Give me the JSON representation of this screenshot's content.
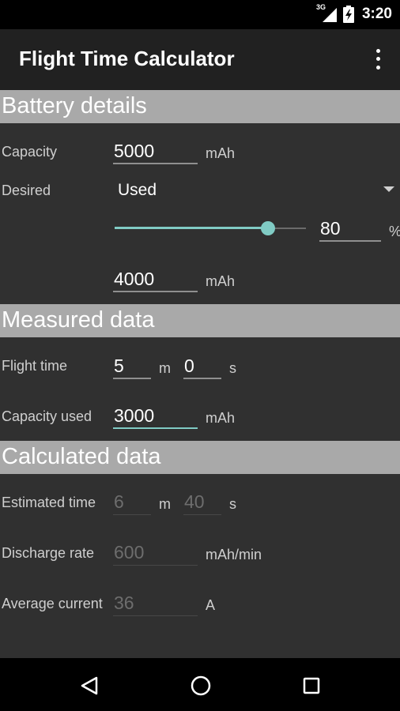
{
  "status_bar": {
    "network": "3G",
    "time": "3:20"
  },
  "app_bar": {
    "title": "Flight Time Calculator"
  },
  "battery": {
    "header": "Battery details",
    "capacity_label": "Capacity",
    "capacity_value": "5000",
    "capacity_unit": "mAh",
    "desired_label": "Desired",
    "desired_selected": "Used",
    "slider_fraction": 0.8,
    "percent_value": "80",
    "percent_unit": "%",
    "desired_capacity_value": "4000",
    "desired_capacity_unit": "mAh"
  },
  "measured": {
    "header": "Measured data",
    "flight_time_label": "Flight time",
    "minutes_value": "5",
    "minutes_unit": "m",
    "seconds_value": "0",
    "seconds_unit": "s",
    "capacity_used_label": "Capacity used",
    "capacity_used_value": "3000",
    "capacity_used_unit": "mAh"
  },
  "calculated": {
    "header": "Calculated data",
    "estimated_time_label": "Estimated time",
    "estimated_minutes": "6",
    "minutes_unit": "m",
    "estimated_seconds": "40",
    "seconds_unit": "s",
    "discharge_rate_label": "Discharge rate",
    "discharge_rate_value": "600",
    "discharge_rate_unit": "mAh/min",
    "average_current_label": "Average current",
    "average_current_value": "36",
    "average_current_unit": "A"
  },
  "colors": {
    "accent": "#80cbc4",
    "section_header": "#a9a9a9",
    "background": "#303030",
    "app_bar": "#212121"
  },
  "icons": {
    "signal": "signal-3g-icon",
    "battery": "battery-charging-icon",
    "overflow": "more-vert-icon",
    "back": "back-triangle-icon",
    "home": "home-circle-icon",
    "recents": "recents-square-icon"
  }
}
